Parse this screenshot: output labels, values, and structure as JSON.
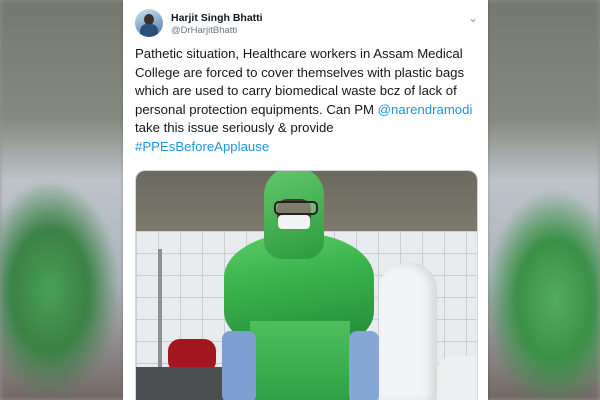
{
  "tweet": {
    "author_name": "Harjit Singh Bhatti",
    "author_handle": "@DrHarjitBhatti",
    "text_line1": "Pathetic situation, Healthcare workers in Assam Medical College are forced to cover themselves with plastic bags which are used to carry biomedical waste bcz of lack of personal protection equipments. Can PM ",
    "mention": "@narendramodi",
    "text_line2": " take this issue seriously & provide ",
    "hashtag": "#PPEsBeforeApplause"
  },
  "icons": {
    "menu": "chevron-down-icon",
    "avatar": "user-avatar"
  },
  "colors": {
    "link": "#1b95e0",
    "text": "#14171a",
    "muted": "#657786"
  }
}
